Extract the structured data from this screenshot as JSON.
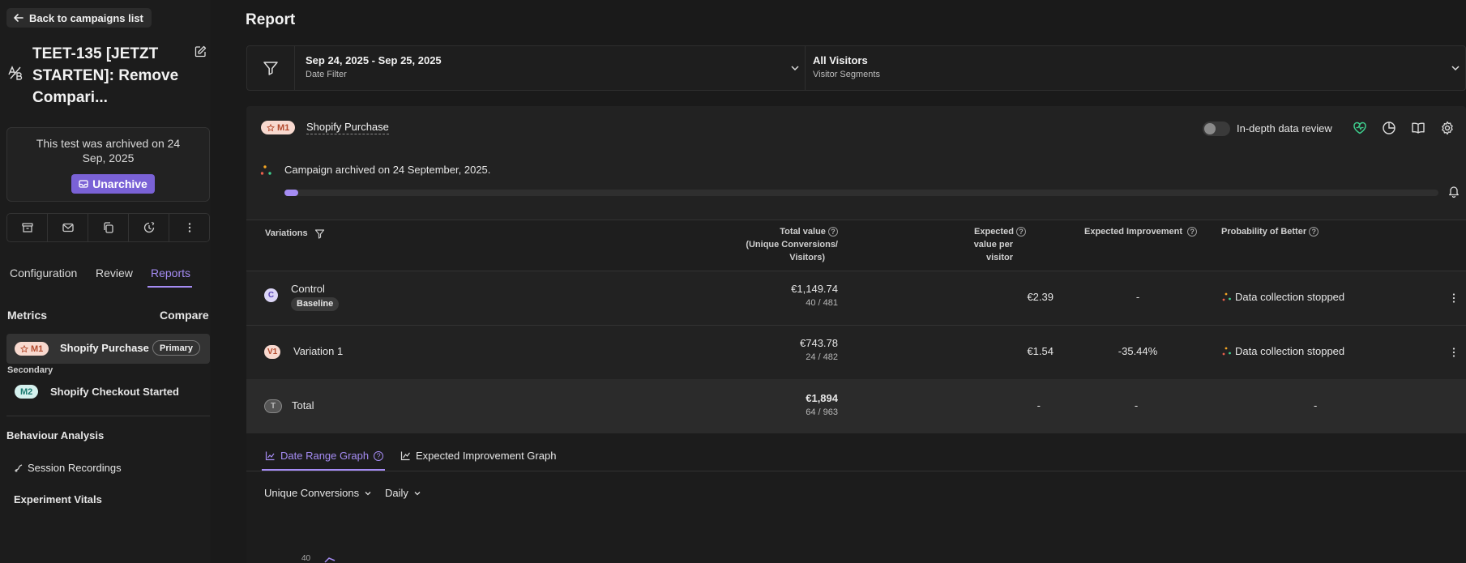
{
  "back_label": "Back to campaigns list",
  "test_title": "TEET-135 [JETZT STARTEN]: Remove Compari...",
  "archived_note": "This test was archived on 24 Sep, 2025",
  "unarchive_label": "Unarchive",
  "tabs": [
    "Configuration",
    "Review",
    "Reports"
  ],
  "metrics_label": "Metrics",
  "compare_label": "Compare",
  "primary_metric": {
    "badge": "M1",
    "name": "Shopify Purchase",
    "pill": "Primary"
  },
  "secondary_label": "Secondary",
  "secondary_metric": {
    "badge": "M2",
    "name": "Shopify Checkout Started"
  },
  "behaviour_label": "Behaviour Analysis",
  "session_recordings": "Session Recordings",
  "experiment_vitals": "Experiment Vitals",
  "report_title": "Report",
  "date_filter": {
    "value": "Sep 24, 2025 - Sep 25, 2025",
    "label": "Date Filter"
  },
  "segment_filter": {
    "value": "All Visitors",
    "label": "Visitor Segments"
  },
  "metric_header": {
    "badge": "M1",
    "name": "Shopify Purchase"
  },
  "in_depth_label": "In-depth data review",
  "campaign_archived": "Campaign archived on 24 September, 2025.",
  "progress_fraction": 0.012,
  "table": {
    "headers": {
      "variations": "Variations",
      "total_value_1": "Total value",
      "total_value_2": "(Unique Conversions/",
      "total_value_3": "Visitors)",
      "expected_1": "Expected",
      "expected_2": "value per",
      "expected_3": "visitor",
      "improvement": "Expected Improvement",
      "probability": "Probability of Better"
    },
    "rows": [
      {
        "badge": "C",
        "name": "Control",
        "tag": "Baseline",
        "value": "€1,149.74",
        "ratio": "40 / 481",
        "epv": "€2.39",
        "improvement": "-",
        "probability": "Data collection stopped"
      },
      {
        "badge": "V1",
        "name": "Variation 1",
        "value": "€743.78",
        "ratio": "24 / 482",
        "epv": "€1.54",
        "improvement": "-35.44%",
        "probability": "Data collection stopped"
      },
      {
        "badge": "T",
        "name": "Total",
        "value": "€1,894",
        "ratio": "64 / 963",
        "epv": "-",
        "improvement": "-",
        "probability": "-"
      }
    ]
  },
  "graph_tabs": [
    "Date Range Graph",
    "Expected Improvement Graph"
  ],
  "graph_controls": {
    "metric": "Unique Conversions",
    "interval": "Daily"
  },
  "graph_y_tick": "40",
  "colors": {
    "accent": "#a58cf3",
    "unarchive": "#7a62d6",
    "m1_bg": "#f8d9cf",
    "m2_bg": "#d5f1ee",
    "health": "#3ecf8e"
  }
}
